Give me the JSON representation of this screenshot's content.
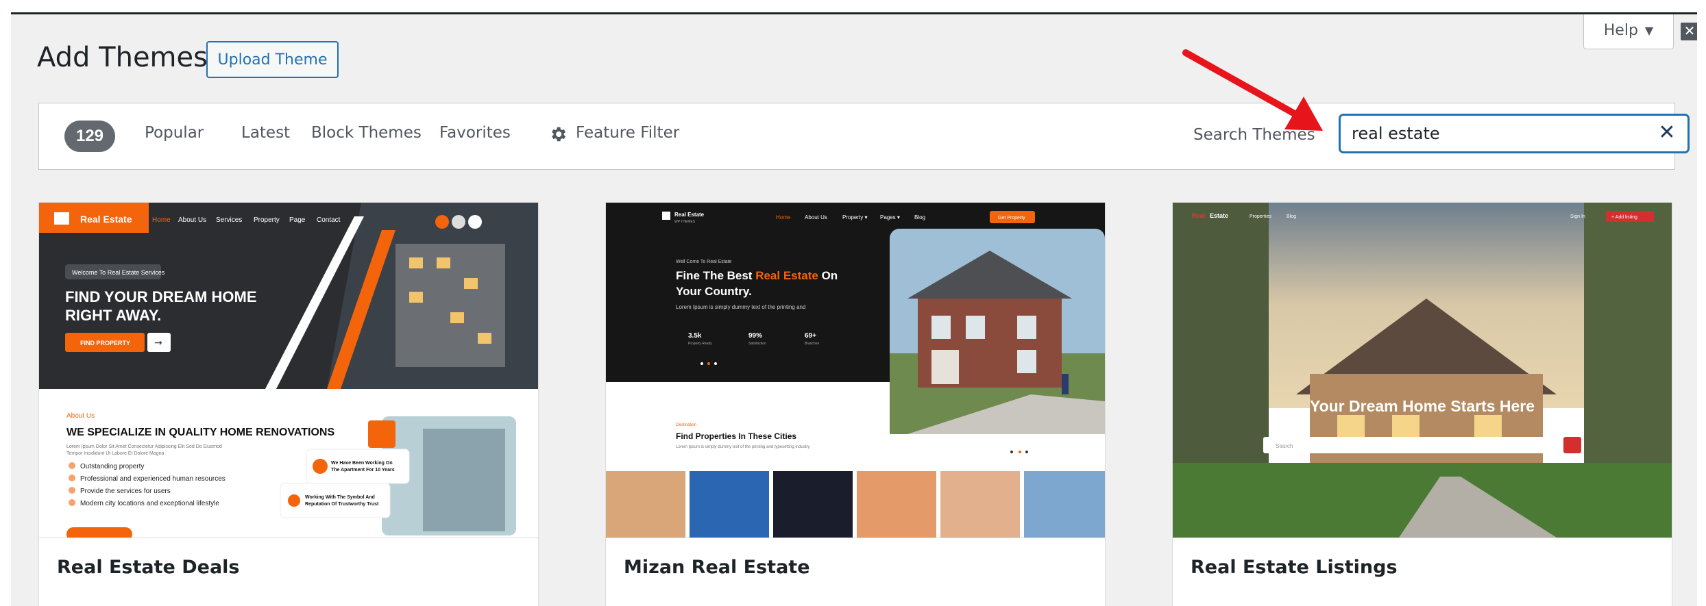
{
  "header": {
    "title": "Add Themes",
    "upload_label": "Upload Theme",
    "help_label": "Help",
    "help_caret": "▼",
    "close_glyph": "✕"
  },
  "filters": {
    "count": "129",
    "tabs": [
      "Popular",
      "Latest",
      "Block Themes",
      "Favorites"
    ],
    "feature_filter": "Feature Filter",
    "search_label": "Search Themes",
    "search_value": "real estate",
    "clear_glyph": "✕"
  },
  "themes": [
    {
      "name": "Real Estate Deals",
      "preview": {
        "logo": "Real Estate",
        "nav": [
          "Home",
          "About Us",
          "Services",
          "Property",
          "Page",
          "Contact"
        ],
        "welcome": "Welcome To Real Estate Services",
        "hero_line1": "FIND YOUR DREAM HOME",
        "hero_line2": "RIGHT AWAY.",
        "cta": "FIND PROPERTY",
        "about_tag": "About Us",
        "about_title": "WE SPECIALIZE IN QUALITY HOME RENOVATIONS",
        "about_text1": "Lorem Ipsum Dolor Sit Amet Consectetur Adipiscing Elit Sed Do Eiusmod",
        "about_text2": "Tempor Incididunt Ut Labore Et Dolore Magna",
        "bullets": [
          "Outstanding property",
          "Professional and experienced human resources",
          "Provide the services for users",
          "Modern city locations and exceptional lifestyle"
        ],
        "badge1a": "We Have Been Working On",
        "badge1b": "The Apartment For 10 Years",
        "badge2a": "Working With The Symbol And",
        "badge2b": "Reputation Of Trustworthy Trust"
      }
    },
    {
      "name": "Mizan Real Estate",
      "preview": {
        "logo": "Real Estate",
        "logo_sub": "WP THEMES",
        "nav": [
          "Home",
          "About Us",
          "Property ▾",
          "Pages ▾",
          "Blog"
        ],
        "nav_btn": "Get Property",
        "welcome": "Well Come To Real Estate",
        "hero_a": "Fine The Best ",
        "hero_b": "Real Estate",
        "hero_c": " On",
        "hero_line2": "Your Country.",
        "hero_text": "Lorem Ipsum is simply dummy text of the printing and",
        "stats": [
          {
            "value": "3.5k",
            "label": "Property Ready"
          },
          {
            "value": "99%",
            "label": "Satisfaction"
          },
          {
            "value": "69+",
            "label": "Branches"
          }
        ],
        "dest_tag": "Destination",
        "dest_title": "Find Properties In These Cities",
        "dest_text": "Lorem Ipsum is simply dummy text of the printing and typesetting industry"
      }
    },
    {
      "name": "Real Estate Listings",
      "preview": {
        "logo_a": "Real",
        "logo_b": "Estate",
        "nav": [
          "Properties",
          "Blog"
        ],
        "signin": "Sign In",
        "add_listing": "+ Add listing",
        "hero": "Your Dream Home Starts Here",
        "search_placeholder": "Search"
      }
    }
  ],
  "colors": {
    "accent": "#2271b1",
    "orange": "#f4640b",
    "arrow": "#e8141b",
    "listing_red": "#d32f2f"
  }
}
